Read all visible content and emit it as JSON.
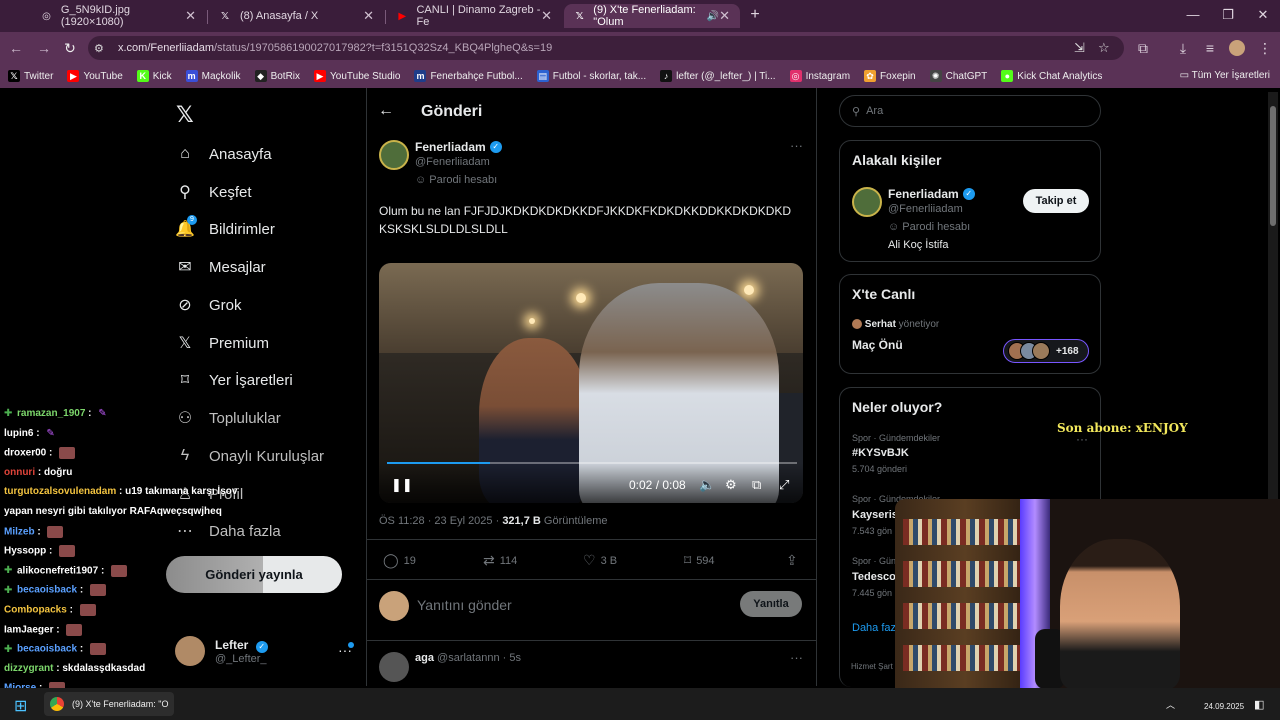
{
  "browser": {
    "tabs": [
      {
        "title": "G_5N9kID.jpg (1920×1080)",
        "icon": "globe-icon"
      },
      {
        "title": "(8) Anasayfa / X",
        "icon": "x-logo-icon"
      },
      {
        "title": "CANLI | Dinamo Zagreb - Fe",
        "icon": "youtube-icon"
      },
      {
        "title": "(9) X'te Fenerliadam: \"Olum",
        "icon": "x-logo-icon"
      }
    ],
    "url_main": "x.com/Fenerliiadam",
    "url_rest": "/status/1970586190027017982?t=f3151Q32Sz4_KBQ4PlgheQ&s=19",
    "bookmarks": [
      {
        "label": "Twitter",
        "icon": "x-logo-icon",
        "color": "#000000"
      },
      {
        "label": "YouTube",
        "icon": "youtube-icon",
        "color": "#ff0000"
      },
      {
        "label": "Kick",
        "icon": "kick-icon",
        "color": "#53fc18"
      },
      {
        "label": "Maçkolik",
        "icon": "mackolik-icon",
        "color": "#3a4fd8"
      },
      {
        "label": "BotRix",
        "icon": "botrix-icon",
        "color": "#222222"
      },
      {
        "label": "YouTube Studio",
        "icon": "youtube-studio-icon",
        "color": "#ff0000"
      },
      {
        "label": "Fenerbahçe Futbol...",
        "icon": "fenerbahce-icon",
        "color": "#1f3d8a"
      },
      {
        "label": "Futbol - skorlar, tak...",
        "icon": "flashscore-icon",
        "color": "#2c62d1"
      },
      {
        "label": "lefter (@_lefter_) | Ti...",
        "icon": "tiktok-icon",
        "color": "#111111"
      },
      {
        "label": "Instagram",
        "icon": "instagram-icon",
        "color": "#e1306c"
      },
      {
        "label": "Foxepin",
        "icon": "foxepin-icon",
        "color": "#f0a030"
      },
      {
        "label": "ChatGPT",
        "icon": "chatgpt-icon",
        "color": "#444444"
      },
      {
        "label": "Kick Chat Analytics",
        "icon": "kick-analytics-icon",
        "color": "#53fc18"
      }
    ],
    "bookmarks_all": "Tüm Yer İşaretleri"
  },
  "sidebar": {
    "items": [
      {
        "label": "Anasayfa",
        "icon": "home-icon"
      },
      {
        "label": "Keşfet",
        "icon": "search-icon"
      },
      {
        "label": "Bildirimler",
        "icon": "bell-icon"
      },
      {
        "label": "Mesajlar",
        "icon": "mail-icon"
      },
      {
        "label": "Grok",
        "icon": "grok-icon"
      },
      {
        "label": "Premium",
        "icon": "x-logo-icon"
      },
      {
        "label": "Yer İşaretleri",
        "icon": "bookmark-icon"
      },
      {
        "label": "Topluluklar",
        "icon": "people-icon"
      },
      {
        "label": "Onaylı Kuruluşlar",
        "icon": "lightning-icon"
      },
      {
        "label": "Profil",
        "icon": "person-icon"
      },
      {
        "label": "Daha fazla",
        "icon": "more-circle-icon"
      }
    ],
    "notif_count": "9",
    "post_button": "Gönderi yayınla",
    "me": {
      "name": "Lefter",
      "handle": "@_Lefter_"
    }
  },
  "post": {
    "header_title": "Gönderi",
    "author": "Fenerliadam",
    "handle": "@Fenerliiadam",
    "parody": "Parodi hesabı",
    "text": "Olum bu ne lan FJFJDJKDKDKDKDKKDFJKKDKFKDKDKKDDKKDKDKDKDKSKSKLSLDLDLSLDLL",
    "video": {
      "time": "0:02 / 0:08",
      "progress": 0.25
    },
    "time": "ÖS 11:28 · 23 Eyl 2025 · ",
    "views_count": "321,7 B",
    "views_label": "Görüntüleme",
    "stats": {
      "replies": "19",
      "reposts": "114",
      "likes": "3 B",
      "bookmarks": "594"
    },
    "reply_placeholder": "Yanıtını gönder",
    "reply_button": "Yanıtla"
  },
  "comment": {
    "name": "aga",
    "handle": "@sarlatannn",
    "time": "· 5s"
  },
  "right": {
    "search_placeholder": "Ara",
    "related_title": "Alakalı kişiler",
    "related": {
      "name": "Fenerliadam",
      "handle": "@Fenerliiadam",
      "parody": "Parodi hesabı",
      "bio": "Ali Koç İstifa",
      "follow": "Takip et"
    },
    "live_title": "X'te Canlı",
    "live": {
      "host": "Serhat",
      "host_suffix": " yönetiyor",
      "title": "Maç Önü",
      "count": "+168"
    },
    "trends_title": "Neler oluyor?",
    "trends": [
      {
        "category": "Spor · Gündemdekiler",
        "name": "#KYSvBJK",
        "count": "5.704 gönderi"
      },
      {
        "category": "Spor · Gündemdekiler",
        "name": "Kayseris",
        "count": "7.543 gön"
      },
      {
        "category": "Spor · Gün",
        "name": "Tedesco",
        "count": "7.445 gön"
      }
    ],
    "show_more": "Daha faz",
    "footer": "Hizmet Şart"
  },
  "stream": {
    "sub_text": "Son abone: xENJOY",
    "chat": [
      {
        "user": "ramazan_1907",
        "msg": "",
        "color": "#7cd66b",
        "badge": true,
        "feather": true
      },
      {
        "user": "lupin6",
        "msg": "",
        "color": "#ffffff",
        "badge": false,
        "feather": true
      },
      {
        "user": "droxer00",
        "msg": "",
        "color": "#ffffff",
        "badge": false,
        "emote": true
      },
      {
        "user": "onnuri",
        "msg": "doğru",
        "color": "#e0443a",
        "badge": false
      },
      {
        "user": "turgutozalsovulenadam",
        "msg": "u19 takımana karşı İşov",
        "color": "#f2c340",
        "badge": false
      },
      {
        "user": "",
        "msg": "yapan nesyri gibi takılıyor RAFAqweçsqwjheq",
        "color": "#ffffff",
        "badge": false
      },
      {
        "user": "Milzeb",
        "msg": "",
        "color": "#5aa0ff",
        "badge": false,
        "emote": true
      },
      {
        "user": "Hyssopp",
        "msg": "",
        "color": "#ffffff",
        "badge": false,
        "emote": true
      },
      {
        "user": "alikocnefreti1907",
        "msg": "",
        "color": "#ffffff",
        "badge": true,
        "emote": true
      },
      {
        "user": "becaoisback",
        "msg": "",
        "color": "#5aa0ff",
        "badge": true,
        "emote": true
      },
      {
        "user": "Combopacks",
        "msg": "",
        "color": "#f2c340",
        "badge": false,
        "emote": true
      },
      {
        "user": "IamJaeger",
        "msg": "",
        "color": "#ffffff",
        "badge": false,
        "emote": true
      },
      {
        "user": "becaoisback",
        "msg": "",
        "color": "#5aa0ff",
        "badge": true,
        "emote": true
      },
      {
        "user": "dizzygrant",
        "msg": "skdalasşdkasdad",
        "color": "#7cd66b",
        "badge": false
      },
      {
        "user": "Miorse",
        "msg": "",
        "color": "#5aa0ff",
        "badge": false,
        "emote": true
      }
    ]
  },
  "taskbar": {
    "app": "(9) X'te Fenerliadam: \"O",
    "date": "24.09.2025"
  }
}
